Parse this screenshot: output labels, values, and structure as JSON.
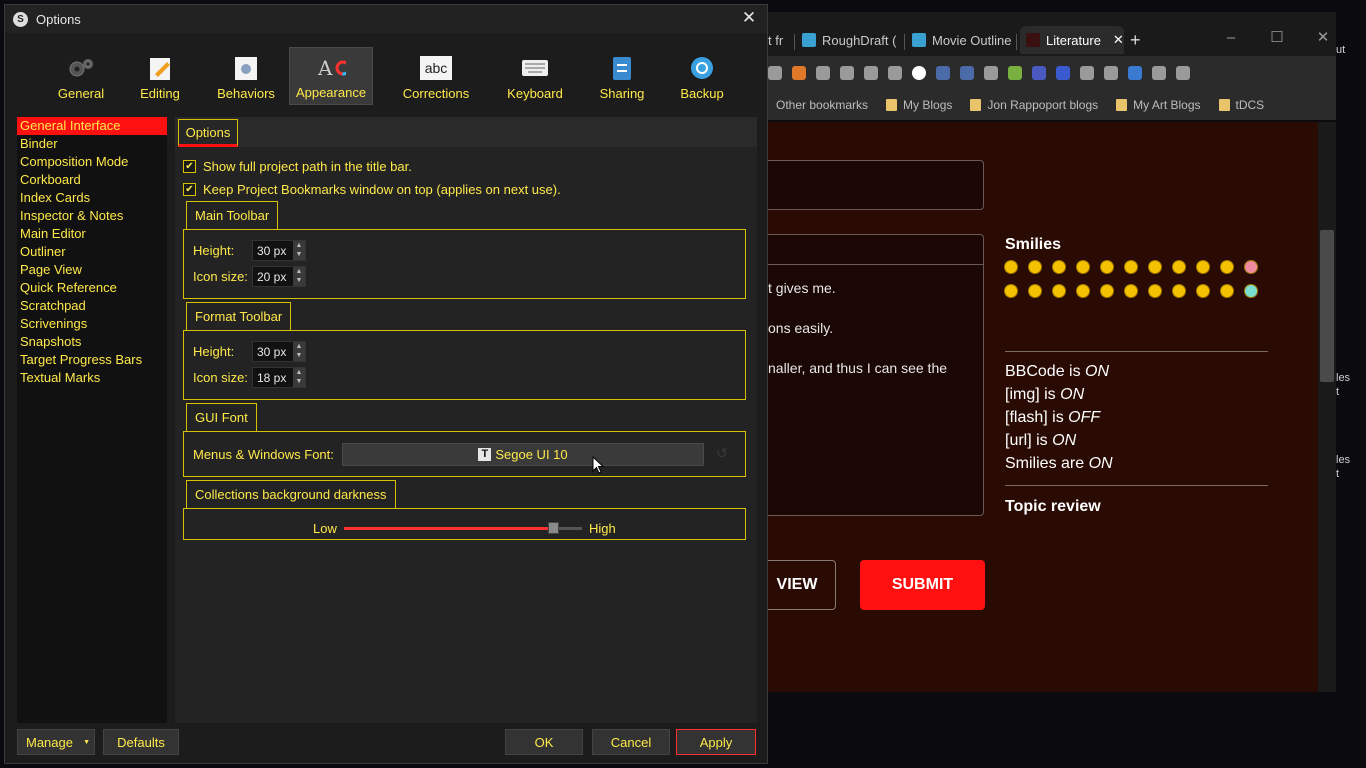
{
  "dialog": {
    "title": "Options",
    "app_icon_letter": "S",
    "close_glyph": "✕"
  },
  "categories": [
    {
      "label": "General",
      "icon": "gears-icon"
    },
    {
      "label": "Editing",
      "icon": "pencil-page-icon"
    },
    {
      "label": "Behaviors",
      "icon": "gear-page-icon"
    },
    {
      "label": "Appearance",
      "icon": "typography-palette-icon",
      "active": true
    },
    {
      "label": "Corrections",
      "icon": "abc-icon"
    },
    {
      "label": "Keyboard",
      "icon": "keyboard-icon"
    },
    {
      "label": "Sharing",
      "icon": "sharing-icon"
    },
    {
      "label": "Backup",
      "icon": "backup-icon"
    }
  ],
  "sidebar": {
    "items": [
      "General Interface",
      "Binder",
      "Composition Mode",
      "Corkboard",
      "Index Cards",
      "Inspector & Notes",
      "Main Editor",
      "Outliner",
      "Page View",
      "Quick Reference",
      "Scratchpad",
      "Scrivenings",
      "Snapshots",
      "Target Progress Bars",
      "Textual Marks"
    ],
    "selected": 0
  },
  "options": {
    "tab_label": "Options",
    "check1": "Show full project path in the title bar.",
    "check2": "Keep Project Bookmarks window on top (applies on next use).",
    "main_toolbar": {
      "title": "Main Toolbar",
      "height_label": "Height:",
      "height": "30 px",
      "icon_label": "Icon size:",
      "icon_size": "20 px"
    },
    "format_toolbar": {
      "title": "Format Toolbar",
      "height_label": "Height:",
      "height": "30 px",
      "icon_label": "Icon size:",
      "icon_size": "18 px"
    },
    "gui_font": {
      "title": "GUI Font",
      "label": "Menus & Windows Font:",
      "value": "Segoe UI 10"
    },
    "collections": {
      "title": "Collections background darkness",
      "low": "Low",
      "high": "High",
      "level": 0.88
    }
  },
  "buttons": {
    "manage": "Manage",
    "defaults": "Defaults",
    "ok": "OK",
    "cancel": "Cancel",
    "apply": "Apply"
  },
  "browser": {
    "tabs": [
      "t fr",
      "RoughDraft (",
      "Movie Outline",
      "Literature"
    ],
    "new_tab": "+",
    "bookmarks": [
      "Other bookmarks",
      "My Blogs",
      "Jon Rappoport blogs",
      "My Art Blogs",
      "tDCS"
    ],
    "text_lines": [
      "t gives me.",
      "ons easily.",
      "naller, and thus I can see the"
    ],
    "smilies_title": "Smilies",
    "bbcode": [
      {
        "pre": "BBCode is ",
        "state": "ON"
      },
      {
        "pre": "[img] is ",
        "state": "ON"
      },
      {
        "pre": "[flash] is ",
        "state": "OFF"
      },
      {
        "pre": "[url] is ",
        "state": "ON"
      },
      {
        "pre": "Smilies are ",
        "state": "ON"
      }
    ],
    "topic_review": "Topic review",
    "view_button": "VIEW",
    "submit_button": "SUBMIT",
    "peek_right": [
      "ut",
      "les",
      "t",
      "les",
      "t"
    ]
  },
  "colors": {
    "accent_text": "#ffe94a",
    "selection": "#ff1010",
    "submit": "#ff1010",
    "page_bg": "#2a0b04"
  }
}
